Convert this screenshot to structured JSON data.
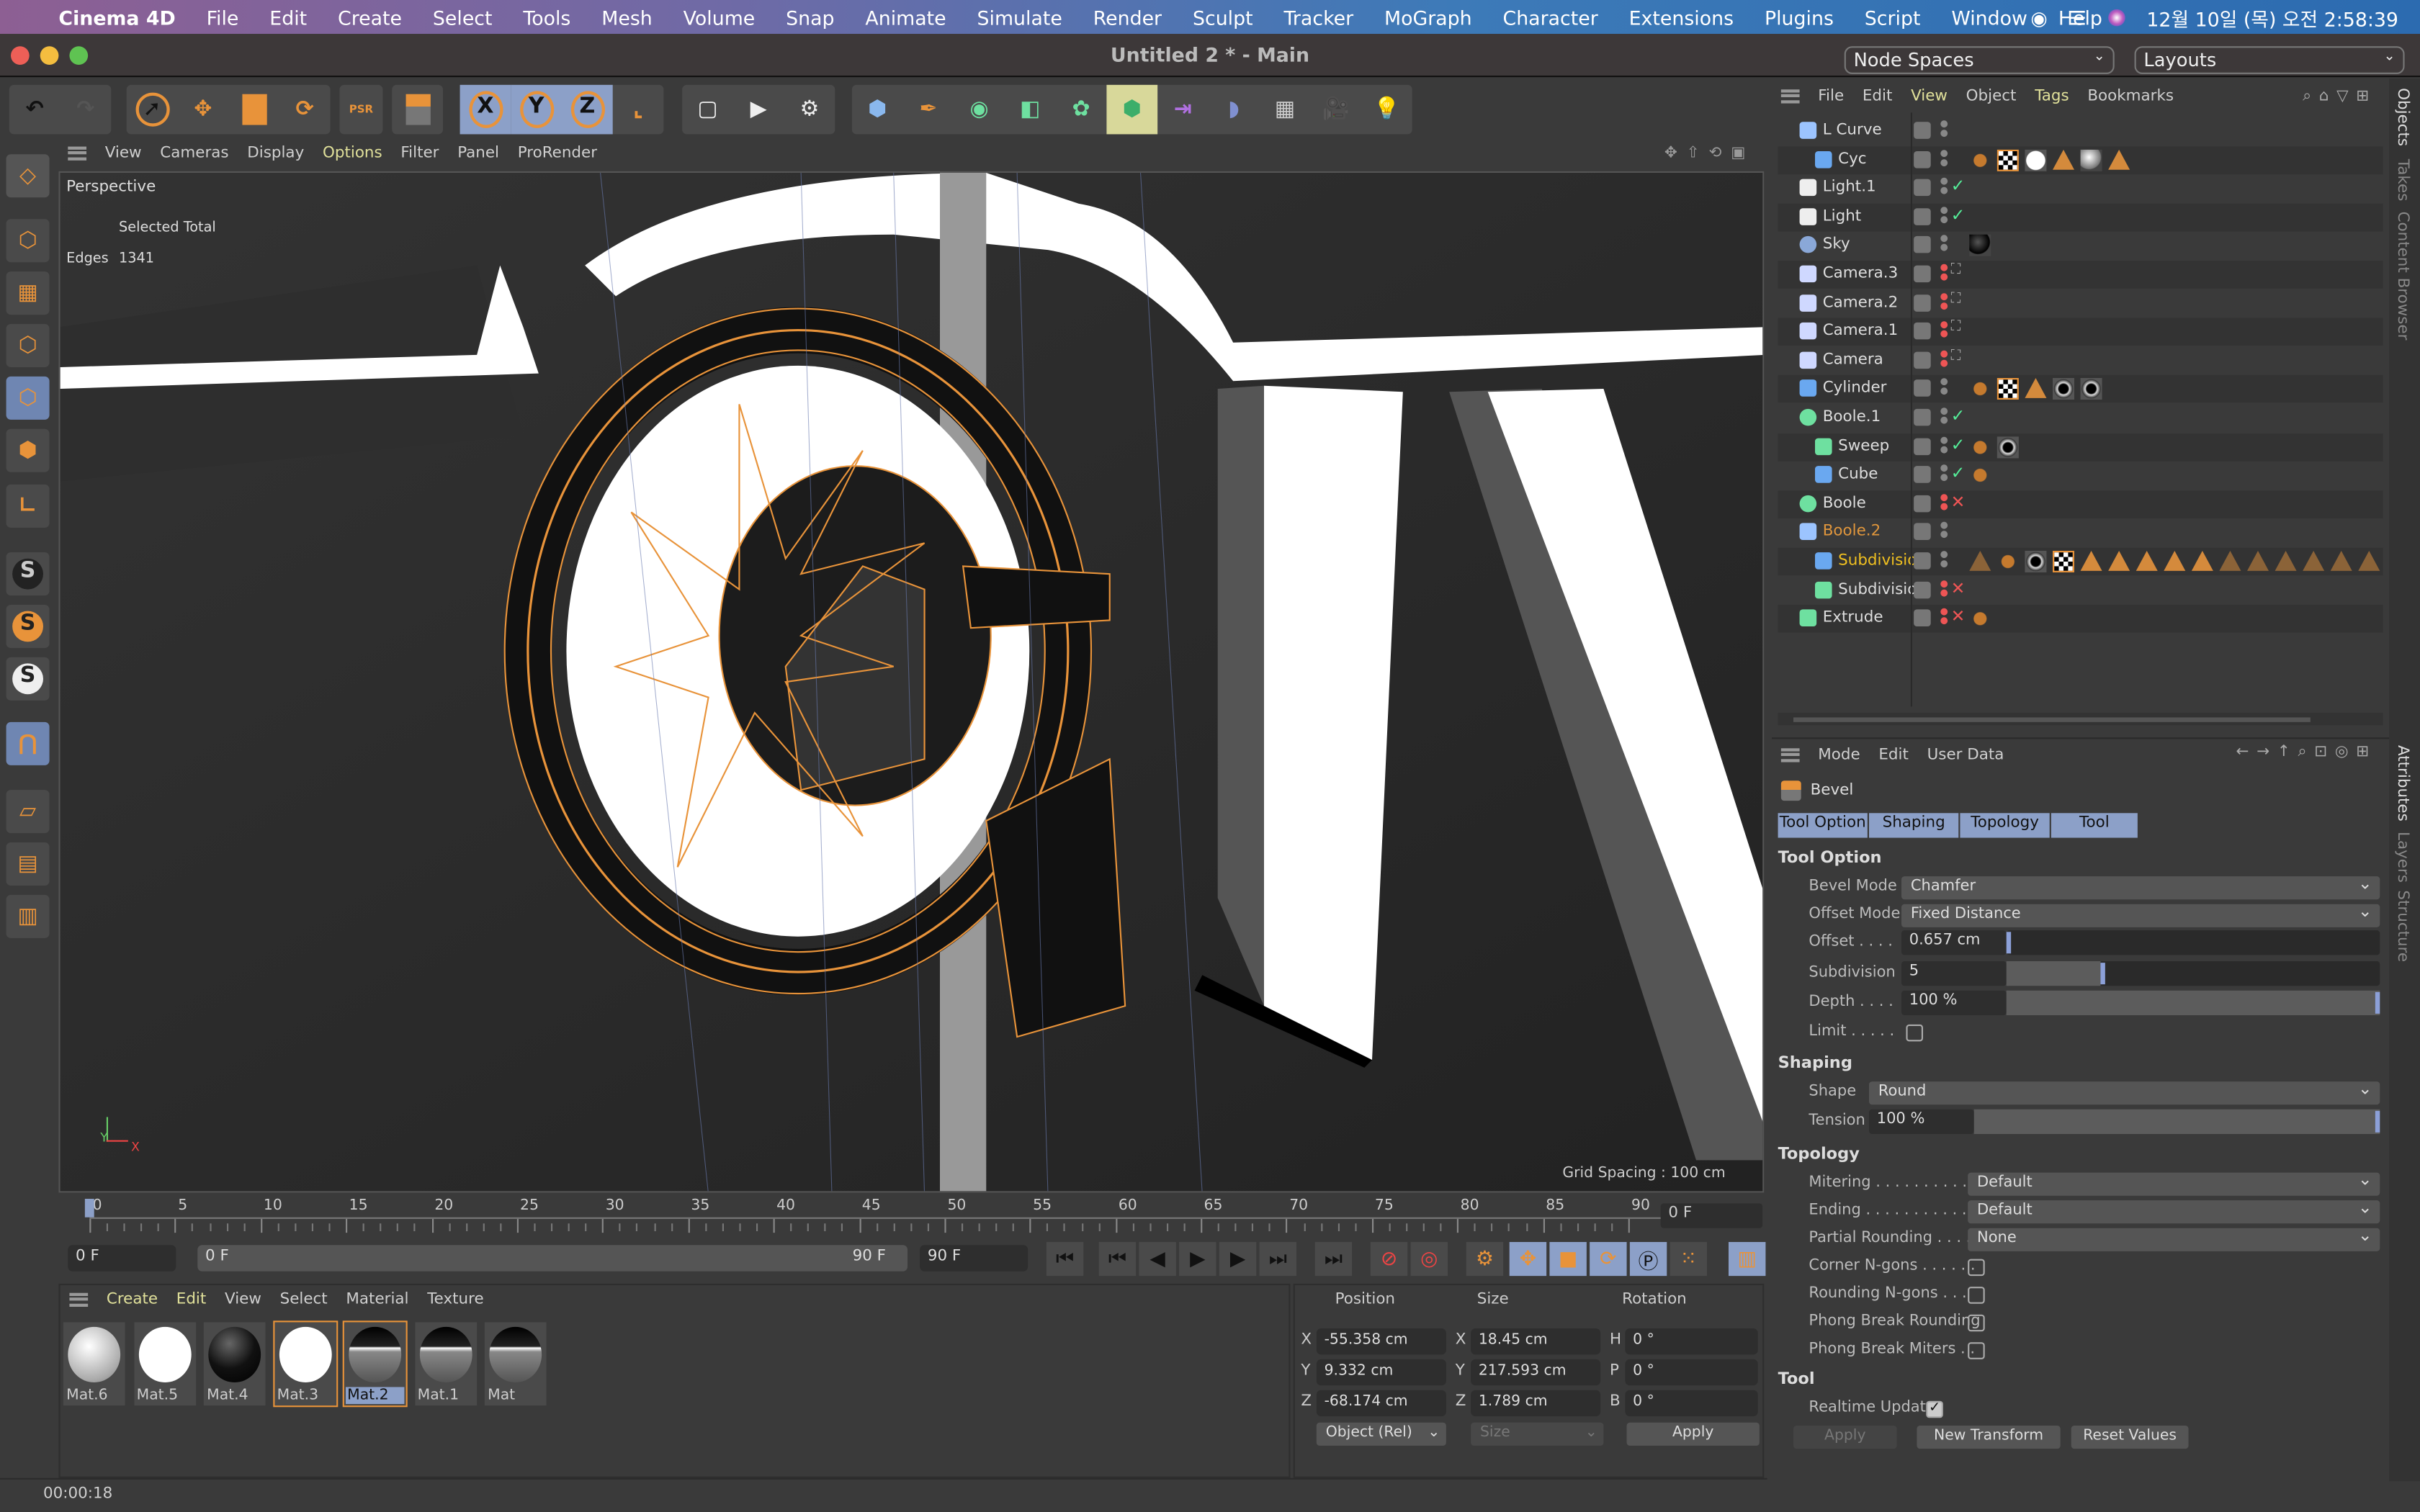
{
  "menubar": {
    "app": "Cinema 4D",
    "items": [
      "File",
      "Edit",
      "Create",
      "Select",
      "Tools",
      "Mesh",
      "Volume",
      "Snap",
      "Animate",
      "Simulate",
      "Render",
      "Sculpt",
      "Tracker",
      "MoGraph",
      "Character",
      "Extensions",
      "Plugins",
      "Script",
      "Window",
      "Help"
    ],
    "clock": "12월 10일 (목) 오전  2:58:39"
  },
  "window": {
    "title": "Untitled 2 * - Main",
    "node_spaces": "Node Spaces",
    "layouts": "Layouts"
  },
  "toolbar": {
    "icons": [
      "undo-icon",
      "redo-icon",
      "select-icon",
      "move-icon",
      "scale-icon",
      "rotate-icon",
      "psr-icon",
      "model-mode-icon",
      "x-axis-icon",
      "y-axis-icon",
      "z-axis-icon",
      "coordinate-system-icon",
      "render-view-icon",
      "render-picture-viewer-icon",
      "render-settings-icon",
      "cube-icon",
      "pen-icon",
      "subdivision-icon",
      "extrude-icon",
      "cloner-icon",
      "array-icon",
      "symmetry-icon",
      "deformer-icon",
      "floor-icon",
      "camera-icon",
      "light-icon"
    ],
    "axis_labels": [
      "X",
      "Y",
      "Z"
    ],
    "psr_label": "PSR"
  },
  "lefttools": {
    "labels": [
      "S",
      "S",
      "S"
    ]
  },
  "viewport": {
    "menu": [
      "View",
      "Cameras",
      "Display",
      "Options",
      "Filter",
      "Panel",
      "ProRender"
    ],
    "active_menu": "Options",
    "camera_name": "Perspective",
    "hud_header": "Selected  Total",
    "hud_label": "Edges",
    "hud_value": "1341",
    "grid_spacing": "Grid Spacing : 100 cm",
    "axis": {
      "y": "Y",
      "z": "Z",
      "x": "X"
    }
  },
  "timeline": {
    "ticks": [
      "0",
      "5",
      "10",
      "15",
      "20",
      "25",
      "30",
      "35",
      "40",
      "45",
      "50",
      "55",
      "60",
      "65",
      "70",
      "75",
      "80",
      "85",
      "90"
    ],
    "current_frame": "0 F",
    "start": "0 F",
    "range_start": "0 F",
    "range_end": "90 F",
    "end": "90 F",
    "current_display": "0 F",
    "playhead_value": 0
  },
  "materials": {
    "menu": [
      "Create",
      "Edit",
      "View",
      "Select",
      "Material",
      "Texture"
    ],
    "items": [
      {
        "name": "Mat.6",
        "type": "matte-white"
      },
      {
        "name": "Mat.5",
        "type": "white"
      },
      {
        "name": "Mat.4",
        "type": "black"
      },
      {
        "name": "Mat.3",
        "type": "white"
      },
      {
        "name": "Mat.2",
        "type": "chrome",
        "selected": true
      },
      {
        "name": "Mat.1",
        "type": "chrome"
      },
      {
        "name": "Mat",
        "type": "chrome"
      }
    ]
  },
  "coords": {
    "headers": [
      "Position",
      "Size",
      "Rotation"
    ],
    "position": [
      {
        "axis": "X",
        "value": "-55.358 cm"
      },
      {
        "axis": "Y",
        "value": "9.332 cm"
      },
      {
        "axis": "Z",
        "value": "-68.174 cm"
      }
    ],
    "size": [
      {
        "axis": "X",
        "value": "18.45 cm"
      },
      {
        "axis": "Y",
        "value": "217.593 cm"
      },
      {
        "axis": "Z",
        "value": "1.789 cm"
      }
    ],
    "rotation": [
      {
        "axis": "H",
        "value": "0 °"
      },
      {
        "axis": "P",
        "value": "0 °"
      },
      {
        "axis": "B",
        "value": "0 °"
      }
    ],
    "mode": "Object (Rel)",
    "size_mode": "Size",
    "apply": "Apply"
  },
  "status": {
    "time": "00:00:18"
  },
  "objects": {
    "menu": [
      "File",
      "Edit",
      "View",
      "Object",
      "Tags",
      "Bookmarks"
    ],
    "highlighted_menu": [
      "View",
      "Tags"
    ],
    "rows": [
      {
        "name": "L Curve",
        "depth": 0,
        "icon": "lcurve",
        "flag": ""
      },
      {
        "name": "Cyc",
        "depth": 1,
        "icon": "poly",
        "flag": "",
        "tags": [
          "phong",
          "checker",
          "white",
          "tri",
          "grey",
          "tri"
        ]
      },
      {
        "name": "Light.1",
        "depth": 0,
        "icon": "light",
        "flag": "✓"
      },
      {
        "name": "Light",
        "depth": 0,
        "icon": "light",
        "flag": "✓"
      },
      {
        "name": "Sky",
        "depth": 0,
        "icon": "sky",
        "flag": "",
        "tags": [
          "black"
        ]
      },
      {
        "name": "Camera.3",
        "depth": 0,
        "icon": "camera",
        "flag": "⛶"
      },
      {
        "name": "Camera.2",
        "depth": 0,
        "icon": "camera",
        "flag": "⛶"
      },
      {
        "name": "Camera.1",
        "depth": 0,
        "icon": "camera",
        "flag": "⛶"
      },
      {
        "name": "Camera",
        "depth": 0,
        "icon": "camera",
        "flag": "⛶"
      },
      {
        "name": "Cylinder",
        "depth": 0,
        "icon": "poly",
        "flag": "",
        "tags": [
          "phong",
          "checker",
          "tri",
          "chrome",
          "chrome"
        ]
      },
      {
        "name": "Boole.1",
        "depth": 0,
        "icon": "boole",
        "flag": "✓"
      },
      {
        "name": "Sweep",
        "depth": 1,
        "icon": "sweep",
        "flag": "✓",
        "tags": [
          "phong",
          "chrome"
        ]
      },
      {
        "name": "Cube",
        "depth": 1,
        "icon": "cube",
        "flag": "✓",
        "tags": [
          "phong"
        ]
      },
      {
        "name": "Boole",
        "depth": 0,
        "icon": "boole",
        "flag": "✕"
      },
      {
        "name": "Boole.2",
        "depth": 0,
        "icon": "lcurve",
        "flag": "",
        "color": "#e0963c"
      },
      {
        "name": "Subdivisio",
        "depth": 1,
        "icon": "poly",
        "flag": "",
        "color": "#f0c020",
        "tags": [
          "tri-o",
          "phong",
          "chrome",
          "checker",
          "tri",
          "tri",
          "tri",
          "tri",
          "tri",
          "tri-o",
          "tri-o",
          "tri-o",
          "tri-o",
          "tri-o",
          "tri-o"
        ]
      },
      {
        "name": "Subdivisio",
        "depth": 1,
        "icon": "subdiv",
        "flag": "✕"
      },
      {
        "name": "Extrude",
        "depth": 0,
        "icon": "extrude",
        "flag": "✕",
        "tags": [
          "phong"
        ]
      }
    ]
  },
  "attributes": {
    "menu": [
      "Mode",
      "Edit",
      "User Data"
    ],
    "object": "Bevel",
    "tabs": [
      "Tool Option",
      "Shaping",
      "Topology",
      "Tool"
    ],
    "tool_option": {
      "heading": "Tool Option",
      "bevel_mode_label": "Bevel Mode",
      "bevel_mode": "Chamfer",
      "offset_mode_label": "Offset Mode",
      "offset_mode": "Fixed Distance",
      "offset_label": "Offset . . . .",
      "offset": "0.657 cm",
      "offset_fraction": 0.0,
      "subdivision_label": "Subdivision",
      "subdivision": "5",
      "subdivision_fraction": 0.25,
      "depth_label": "Depth . . . .",
      "depth": "100 %",
      "depth_fraction": 1.0,
      "limit_label": "Limit . . . . .",
      "limit": false
    },
    "shaping": {
      "heading": "Shaping",
      "shape_label": "Shape",
      "shape": "Round",
      "tension_label": "Tension",
      "tension": "100 %",
      "tension_fraction": 1.0
    },
    "topology": {
      "heading": "Topology",
      "mitering_label": "Mitering . . . . . . . . . .",
      "mitering": "Default",
      "ending_label": "Ending . . . . . . . . . . .",
      "ending": "Default",
      "partial_label": "Partial Rounding . . . .",
      "partial": "None",
      "checks": [
        {
          "label": "Corner N-gons . . . . . .",
          "checked": false
        },
        {
          "label": "Rounding N-gons . . .",
          "checked": false
        },
        {
          "label": "Phong Break Rounding",
          "checked": false
        },
        {
          "label": "Phong Break Miters . .",
          "checked": false
        }
      ]
    },
    "tool": {
      "heading": "Tool",
      "realtime_label": "Realtime Update",
      "realtime": true,
      "apply": "Apply",
      "new_transform": "New Transform",
      "reset": "Reset Values"
    }
  },
  "side_tabs": {
    "top": [
      "Objects",
      "Takes",
      "Content Browser"
    ],
    "bottom": [
      "Attributes",
      "Layers",
      "Structure"
    ]
  },
  "colors": {
    "accent_blue": "#8ca0c8",
    "orange": "#e8933a",
    "highlight_yellow": "#e0e09a"
  }
}
